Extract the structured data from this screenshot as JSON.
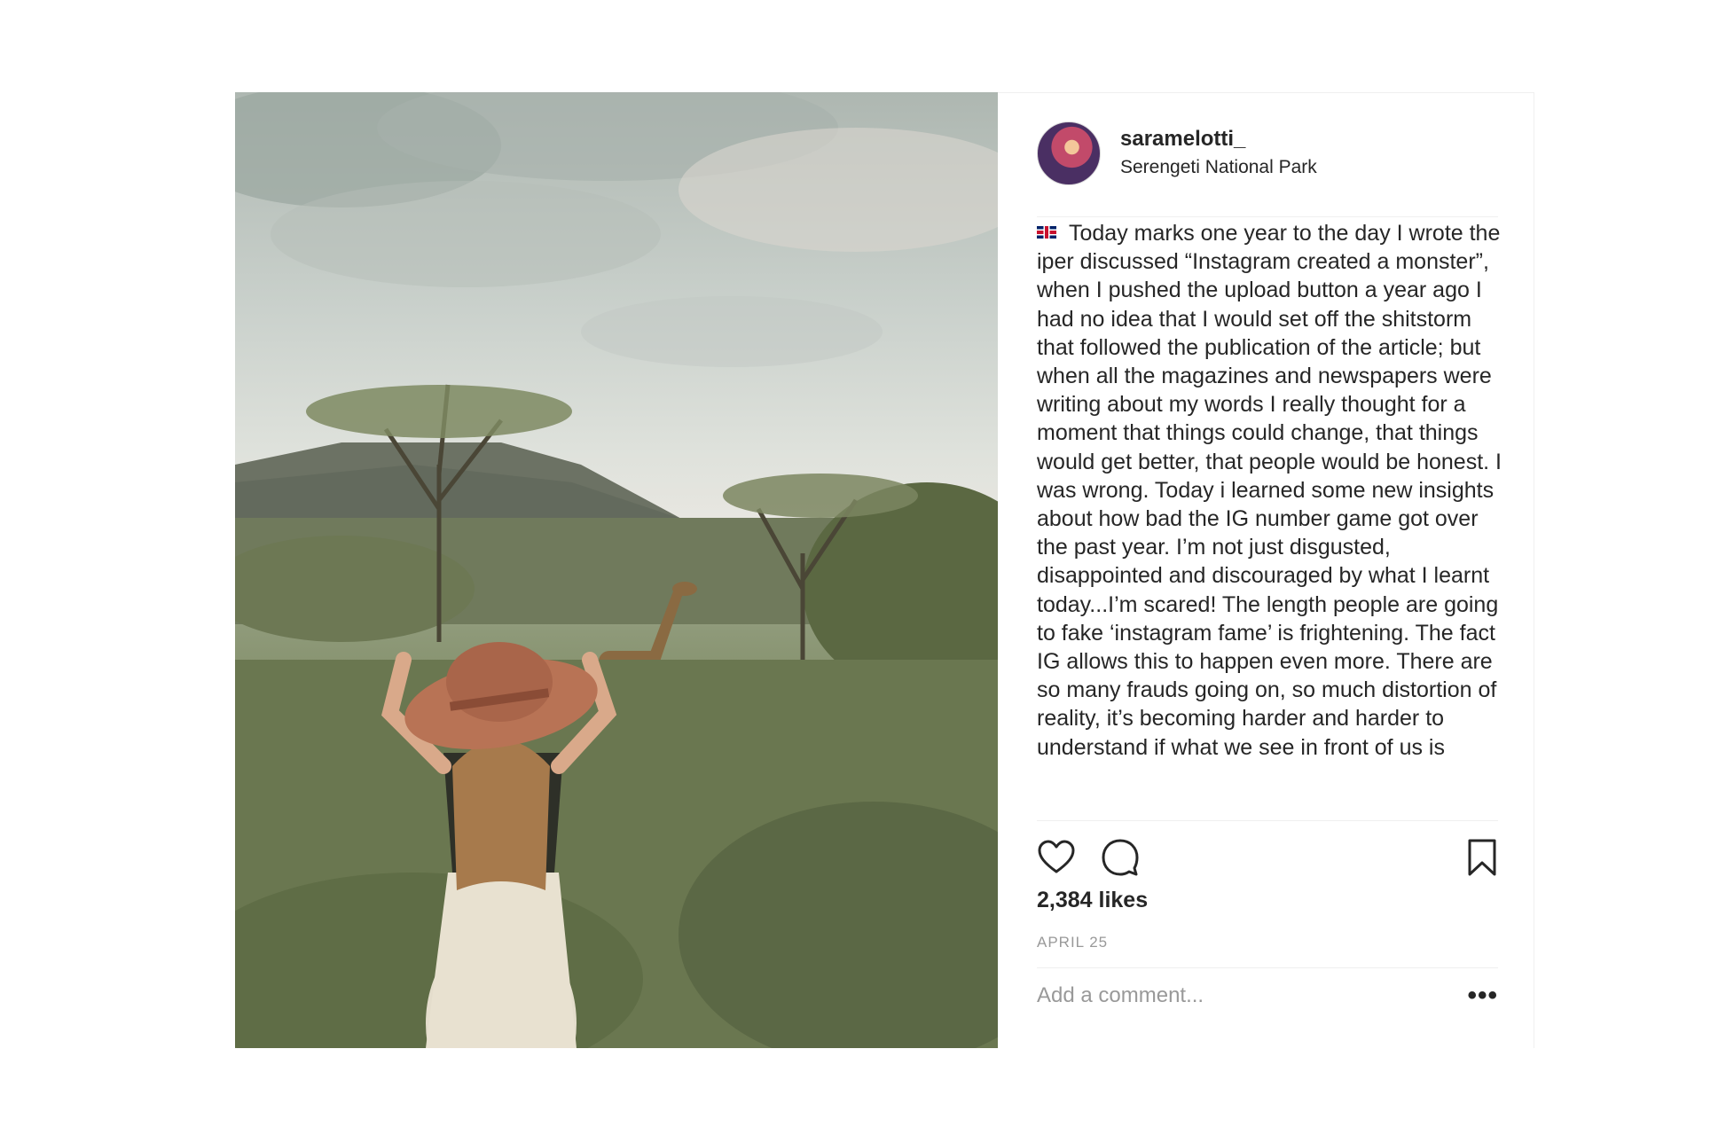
{
  "post": {
    "photo": {
      "description_icon": "safari-photo",
      "colors": {
        "sky": "#c9d0cb",
        "grass": "#6f7d54",
        "hat": "#b87355"
      }
    },
    "header": {
      "username": "saramelotti_",
      "location": "Serengeti National Park"
    },
    "caption": {
      "flag_icon": "uk-flag-icon",
      "text": "Today marks one year to the day I wrote the iper discussed “Instagram created a monster”, when I pushed the upload button a year ago I had no idea that I would set off the shitstorm that followed the publication of the article; but when all the magazines and newspapers were writing about my words I really thought for a moment that things could change, that things would get better, that people would be honest. I was wrong. Today i learned some new insights about how bad the IG number game got over the past year. I’m not just disgusted, disappointed and discouraged by what I learnt today...I’m scared! The length people are going to fake ‘instagram fame’ is frightening. The fact IG allows this to happen even more. There are so many frauds going on, so much distortion of reality, it’s becoming harder and harder to understand if what we see in front of us is"
    },
    "actions": {
      "like_icon": "heart-icon",
      "comment_icon": "comment-icon",
      "save_icon": "bookmark-icon"
    },
    "likes": "2,384 likes",
    "date": "APRIL 25",
    "comment": {
      "placeholder": "Add a comment...",
      "more_label": "•••"
    }
  }
}
